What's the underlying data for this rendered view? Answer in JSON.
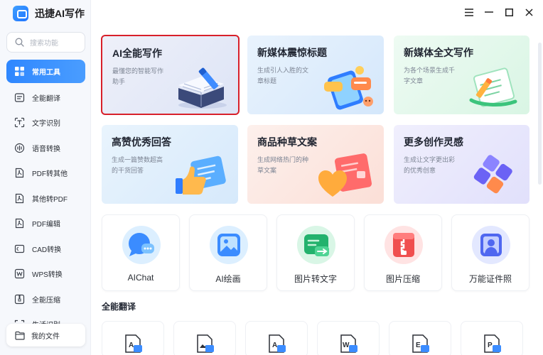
{
  "app": {
    "title": "迅捷AI写作"
  },
  "search": {
    "placeholder": "搜索功能"
  },
  "sidebar": {
    "items": [
      {
        "label": "常用工具",
        "icon": "grid-icon",
        "active": true
      },
      {
        "label": "全能翻译",
        "icon": "translate-icon"
      },
      {
        "label": "文字识别",
        "icon": "text-scan-icon"
      },
      {
        "label": "语音转换",
        "icon": "audio-icon"
      },
      {
        "label": "PDF转其他",
        "icon": "pdf-icon"
      },
      {
        "label": "其他转PDF",
        "icon": "pdf-convert-icon"
      },
      {
        "label": "PDF编辑",
        "icon": "pdf-edit-icon"
      },
      {
        "label": "CAD转换",
        "icon": "cad-icon"
      },
      {
        "label": "WPS转换",
        "icon": "wps-icon"
      },
      {
        "label": "全能压缩",
        "icon": "compress-icon"
      },
      {
        "label": "生活识别",
        "icon": "scan-icon"
      }
    ],
    "my_files": "我的文件"
  },
  "cards": [
    {
      "title": "AI全能写作",
      "desc": "最懂您的智能写作助手",
      "icon": "book-pen-icon"
    },
    {
      "title": "新媒体震惊标题",
      "desc": "生成引人入胜的文章标题",
      "icon": "phone-chat-icon"
    },
    {
      "title": "新媒体全文写作",
      "desc": "为各个场景生成千字文章",
      "icon": "notepad-pen-icon"
    },
    {
      "title": "高赞优秀回答",
      "desc": "生成一篇赞数超高的干货回答",
      "icon": "thumbs-up-icon"
    },
    {
      "title": "商品种草文案",
      "desc": "生成网络热门的种草文案",
      "icon": "heart-bag-icon"
    },
    {
      "title": "更多创作灵感",
      "desc": "生成让文字更出彩的优秀创意",
      "icon": "blocks-icon"
    }
  ],
  "tools": [
    {
      "label": "AIChat",
      "icon": "chat-bubble-icon"
    },
    {
      "label": "AI绘画",
      "icon": "image-icon"
    },
    {
      "label": "图片转文字",
      "icon": "image-to-text-icon"
    },
    {
      "label": "图片压缩",
      "icon": "zip-icon"
    },
    {
      "label": "万能证件照",
      "icon": "id-photo-icon"
    }
  ],
  "section": {
    "title": "全能翻译"
  },
  "translate_tools": [
    {
      "icon": "doc-translate-icon"
    },
    {
      "icon": "image-translate-icon"
    },
    {
      "icon": "pdf-translate-icon"
    },
    {
      "icon": "word-translate-icon"
    },
    {
      "icon": "excel-translate-icon"
    },
    {
      "icon": "ppt-translate-icon"
    }
  ],
  "colors": {
    "accent": "#2f87ff",
    "selected_border": "#d8202a"
  }
}
